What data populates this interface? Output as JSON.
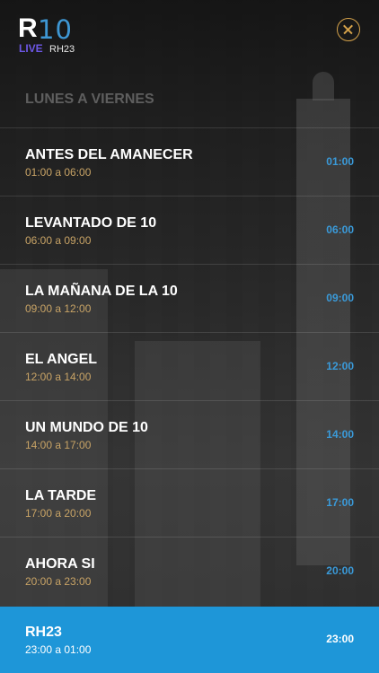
{
  "header": {
    "logo_r": "R",
    "logo_num": "10",
    "logo_live": "LIVE",
    "logo_show": "RH23"
  },
  "section_title": "LUNES A VIERNES",
  "programs": [
    {
      "name": "ANTES DEL AMANECER",
      "range": "01:00 a 06:00",
      "start": "01:00"
    },
    {
      "name": "LEVANTADO DE 10",
      "range": "06:00 a 09:00",
      "start": "06:00"
    },
    {
      "name": "LA MAÑANA DE LA 10",
      "range": "09:00 a 12:00",
      "start": "09:00"
    },
    {
      "name": "EL ANGEL",
      "range": "12:00 a 14:00",
      "start": "12:00"
    },
    {
      "name": "UN MUNDO DE 10",
      "range": "14:00 a 17:00",
      "start": "14:00"
    },
    {
      "name": "LA TARDE",
      "range": "17:00 a 20:00",
      "start": "17:00"
    },
    {
      "name": "AHORA SI",
      "range": "20:00 a 23:00",
      "start": "20:00"
    },
    {
      "name": "RH23",
      "range": "23:00 a 01:00",
      "start": "23:00"
    }
  ],
  "colors": {
    "accent": "#1e96d8",
    "time_blue": "#3a9ad9",
    "range_gold": "#c9a466",
    "close_gold": "#d5a24a"
  },
  "icons": {
    "close": "close-circle-icon"
  }
}
